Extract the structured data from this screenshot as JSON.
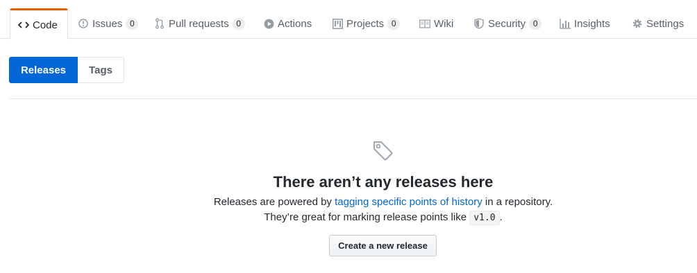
{
  "reponav": {
    "tabs": [
      {
        "label": "Code",
        "icon": "code-icon",
        "selected": true
      },
      {
        "label": "Issues",
        "icon": "issue-icon",
        "count": "0"
      },
      {
        "label": "Pull requests",
        "icon": "pull-request-icon",
        "count": "0"
      },
      {
        "label": "Actions",
        "icon": "play-icon"
      },
      {
        "label": "Projects",
        "icon": "project-icon",
        "count": "0"
      },
      {
        "label": "Wiki",
        "icon": "book-icon"
      },
      {
        "label": "Security",
        "icon": "shield-icon",
        "count": "0"
      },
      {
        "label": "Insights",
        "icon": "graph-icon"
      },
      {
        "label": "Settings",
        "icon": "gear-icon"
      }
    ],
    "selected_color": "#e36209"
  },
  "subnav": {
    "releases_label": "Releases",
    "tags_label": "Tags",
    "selected_color": "#0366d6"
  },
  "blankslate": {
    "icon": "tag-icon",
    "title": "There aren’t any releases here",
    "line1_prefix": "Releases are powered by ",
    "line1_link": "tagging specific points of history",
    "line1_suffix": " in a repository.",
    "line2_prefix": "They’re great for marking release points like ",
    "line2_code": "v1.0",
    "line2_suffix": ".",
    "button_label": "Create a new release"
  }
}
